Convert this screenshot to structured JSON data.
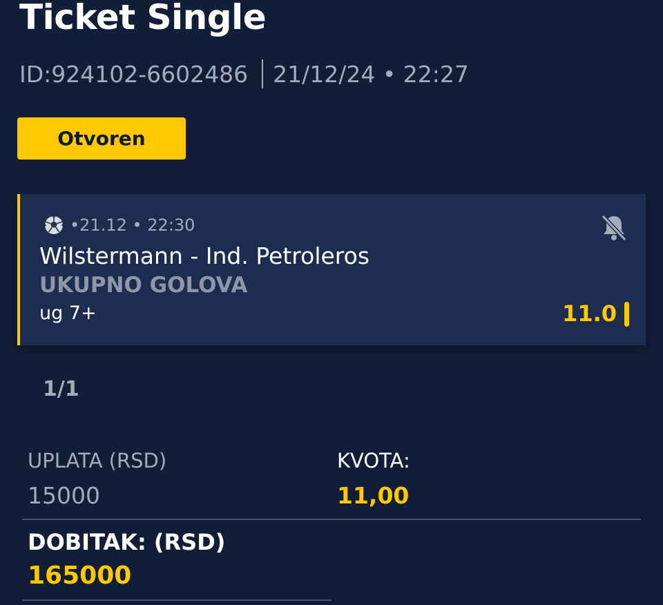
{
  "ticket": {
    "title": "Ticket Single",
    "id_text": "ID:924102-6602486",
    "datetime_text": "21/12/24 • 22:27",
    "status": "Otvoren"
  },
  "bet": {
    "sport_icon": "soccer-ball-icon",
    "event_meta": "•21.12 • 22:30",
    "match": "Wilstermann - Ind. Petroleros",
    "market": "UKUPNO GOLOVA",
    "pick": "ug 7+",
    "odd": "11.0",
    "notification_icon": "bell-off-icon"
  },
  "pager": "1/1",
  "summary": {
    "uplata_label": "UPLATA (RSD)",
    "uplata_value": "15000",
    "kvota_label": "KVOTA:",
    "kvota_value": "11,00",
    "dobitak_label": "DOBITAK: (RSD)",
    "dobitak_value": "165000"
  },
  "colors": {
    "background": "#121e38",
    "card": "#1d2d50",
    "accent": "#ffc800",
    "muted_text": "#a4abbb"
  }
}
